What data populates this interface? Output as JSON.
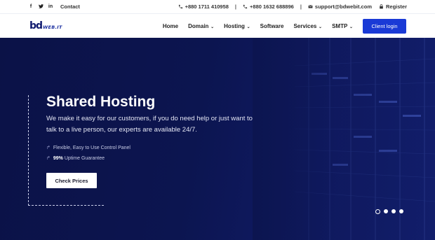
{
  "topbar": {
    "social": [
      "facebook-icon",
      "twitter-icon",
      "linkedin-icon"
    ],
    "contact": "Contact",
    "phone1": "+880 1711 410958",
    "phone2": "+880 1632 688896",
    "email": "support@bdwebit.com",
    "register": "Register"
  },
  "nav": {
    "logo": "BDWEBIT",
    "items": [
      {
        "label": "Home",
        "dropdown": false
      },
      {
        "label": "Domain",
        "dropdown": true
      },
      {
        "label": "Hosting",
        "dropdown": true
      },
      {
        "label": "Software",
        "dropdown": false
      },
      {
        "label": "Services",
        "dropdown": true
      },
      {
        "label": "SMTP",
        "dropdown": true
      }
    ],
    "client_login": "Client login"
  },
  "hero": {
    "title": "Shared Hosting",
    "description": "We make it easy for our customers, if you do need help or just want to talk to a live person, our experts are available 24/7.",
    "feature1": "Flexible, Easy to Use Control Panel",
    "feature2_strong": "99%",
    "feature2_rest": " Uptime Guarantee",
    "cta": "Check Prices",
    "slides": 4,
    "active_slide": 0
  },
  "colors": {
    "accent": "#1a3ad6",
    "hero_bg": "#0c1550",
    "brand": "#101a6e"
  }
}
